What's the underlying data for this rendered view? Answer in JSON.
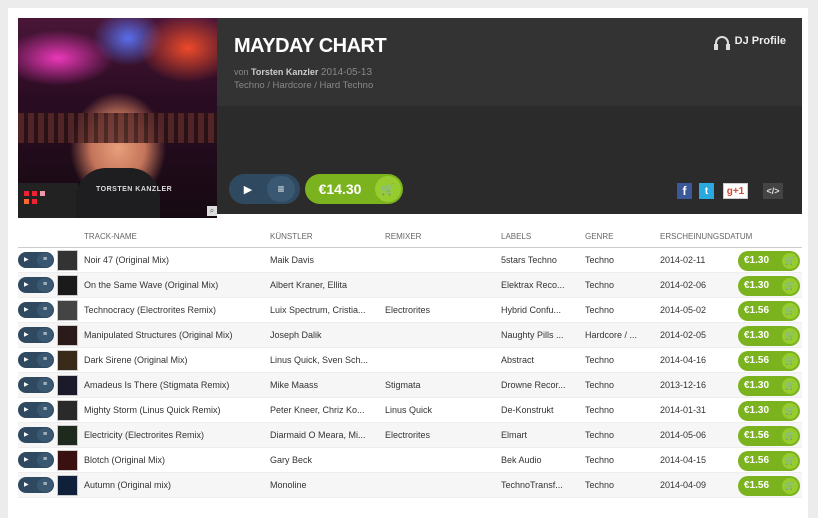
{
  "chart": {
    "title": "MAYDAY CHART",
    "by_prefix": "von",
    "author": "Torsten Kanzler",
    "date": "2014-05-13",
    "genres": "Techno / Hardcore / Hard Techno",
    "price": "€14.30",
    "dj_profile_label": "DJ Profile",
    "cover_shirt_text": "TORSTEN KANZLER",
    "social": {
      "facebook": "f",
      "twitter": "t",
      "googleplus": "g+1",
      "embed": "</>"
    }
  },
  "columns": {
    "track": "TRACK-NAME",
    "artist": "KÜNSTLER",
    "remixer": "REMIXER",
    "labels": "LABELS",
    "genre": "GENRE",
    "release": "ERSCHEINUNGSDATUM"
  },
  "tracks": [
    {
      "name": "Noir 47 (Original Mix)",
      "artist": "Maik Davis",
      "remixer": "",
      "label": "5stars Techno",
      "genre": "Techno",
      "date": "2014-02-11",
      "price": "€1.30"
    },
    {
      "name": "On the Same Wave (Original Mix)",
      "artist": "Albert Kraner, Ellita",
      "remixer": "",
      "label": "Elektrax Reco...",
      "genre": "Techno",
      "date": "2014-02-06",
      "price": "€1.30"
    },
    {
      "name": "Technocracy (Electrorites Remix)",
      "artist": "Luix Spectrum, Cristia...",
      "remixer": "Electrorites",
      "label": "Hybrid Confu...",
      "genre": "Techno",
      "date": "2014-05-02",
      "price": "€1.56"
    },
    {
      "name": "Manipulated Structures (Original Mix)",
      "artist": "Joseph Dalik",
      "remixer": "",
      "label": "Naughty Pills ...",
      "genre": "Hardcore / ...",
      "date": "2014-02-05",
      "price": "€1.30"
    },
    {
      "name": "Dark Sirene (Original Mix)",
      "artist": "Linus Quick, Sven Sch...",
      "remixer": "",
      "label": "Abstract",
      "genre": "Techno",
      "date": "2014-04-16",
      "price": "€1.56"
    },
    {
      "name": "Amadeus Is There (Stigmata Remix)",
      "artist": "Mike Maass",
      "remixer": "Stigmata",
      "label": "Drowne Recor...",
      "genre": "Techno",
      "date": "2013-12-16",
      "price": "€1.30"
    },
    {
      "name": "Mighty Storm (Linus Quick Remix)",
      "artist": "Peter Kneer, Chriz Ko...",
      "remixer": "Linus Quick",
      "label": "De-Konstrukt",
      "genre": "Techno",
      "date": "2014-01-31",
      "price": "€1.30"
    },
    {
      "name": "Electricity (Electrorites Remix)",
      "artist": "Diarmaid O Meara, Mi...",
      "remixer": "Electrorites",
      "label": "Elmart",
      "genre": "Techno",
      "date": "2014-05-06",
      "price": "€1.56"
    },
    {
      "name": "Blotch (Original Mix)",
      "artist": "Gary Beck",
      "remixer": "",
      "label": "Bek Audio",
      "genre": "Techno",
      "date": "2014-04-15",
      "price": "€1.56"
    },
    {
      "name": "Autumn (Original mix)",
      "artist": "Monoline",
      "remixer": "",
      "label": "TechnoTransf...",
      "genre": "Techno",
      "date": "2014-04-09",
      "price": "€1.56"
    }
  ],
  "colors": {
    "accent_green": "#7bb31f",
    "play_blue": "#2f4a60",
    "header_dark": "#333333"
  }
}
